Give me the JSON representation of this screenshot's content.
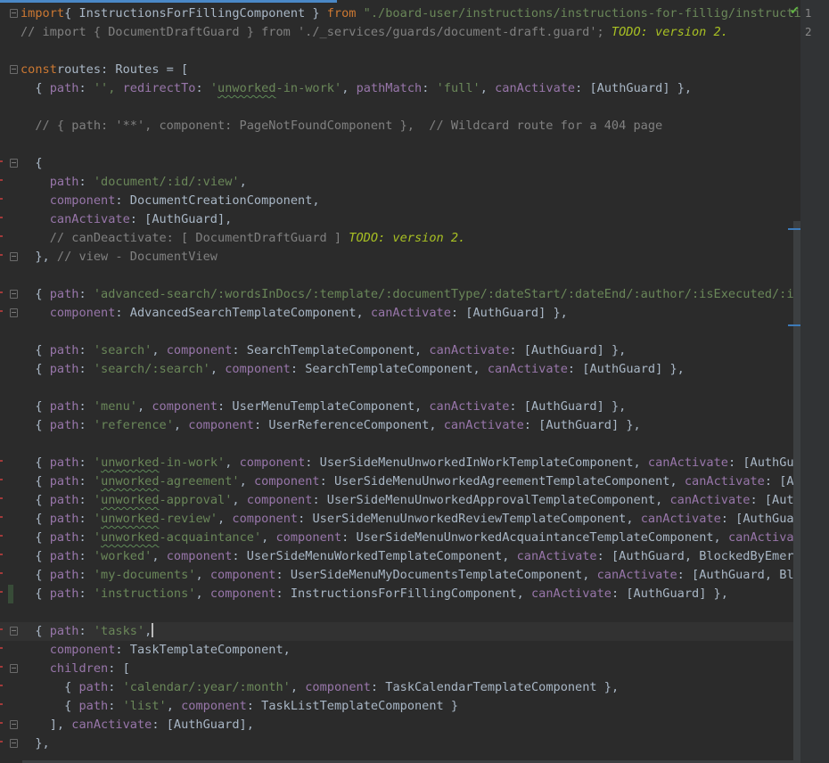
{
  "editor": {
    "language": "TypeScript",
    "line_numbers": [
      "1",
      "2"
    ],
    "lines": [
      [
        [
          "kw",
          "import"
        ],
        [
          "",
          "{ InstructionsForFillingComponent } "
        ],
        [
          "kw",
          "from"
        ],
        [
          "str",
          " \"./board-user/instructions/instructions-for-fillig/instructio"
        ]
      ],
      [
        [
          "cmt",
          "// import { DocumentDraftGuard } from './_services/guards/document-draft.guard'; "
        ],
        [
          "todo",
          "TODO: version 2."
        ]
      ],
      [],
      [
        [
          "kw",
          "const"
        ],
        [
          "",
          "routes: Routes = ["
        ]
      ],
      [
        [
          "",
          "  { "
        ],
        [
          "prop",
          "path"
        ],
        [
          "",
          ": "
        ],
        [
          "str",
          "'', "
        ],
        [
          "prop",
          "redirectTo"
        ],
        [
          "",
          ": "
        ],
        [
          "str",
          "'"
        ],
        [
          "str-typo",
          "unworked"
        ],
        [
          "str",
          "-in-work'"
        ],
        [
          "",
          ", "
        ],
        [
          "prop",
          "pathMatch"
        ],
        [
          "",
          ": "
        ],
        [
          "str",
          "'full'"
        ],
        [
          "",
          ", "
        ],
        [
          "prop",
          "canActivate"
        ],
        [
          "",
          ": [AuthGuard] },"
        ]
      ],
      [],
      [
        [
          "cmt",
          "  // { path: '**', component: PageNotFoundComponent },  // Wildcard route for a 404 page"
        ]
      ],
      [],
      [
        [
          "",
          "  {"
        ]
      ],
      [
        [
          "",
          "    "
        ],
        [
          "prop",
          "path"
        ],
        [
          "",
          ": "
        ],
        [
          "str",
          "'document/:id/:view'"
        ],
        [
          "",
          ","
        ]
      ],
      [
        [
          "",
          "    "
        ],
        [
          "prop",
          "component"
        ],
        [
          "",
          ": DocumentCreationComponent,"
        ]
      ],
      [
        [
          "",
          "    "
        ],
        [
          "prop",
          "canActivate"
        ],
        [
          "",
          ": [AuthGuard],"
        ]
      ],
      [
        [
          "cmt",
          "    // canDeactivate: [ DocumentDraftGuard ] "
        ],
        [
          "todo",
          "TODO: version 2."
        ]
      ],
      [
        [
          "",
          "  }, "
        ],
        [
          "cmt",
          "// view - DocumentView"
        ]
      ],
      [],
      [
        [
          "",
          "  { "
        ],
        [
          "prop",
          "path"
        ],
        [
          "",
          ": "
        ],
        [
          "str",
          "'advanced-search/:wordsInDocs/:template/:documentType/:dateStart/:dateEnd/:author/:isExecuted/:isAut"
        ]
      ],
      [
        [
          "",
          "    "
        ],
        [
          "prop",
          "component"
        ],
        [
          "",
          ": AdvancedSearchTemplateComponent, "
        ],
        [
          "prop",
          "canActivate"
        ],
        [
          "",
          ": [AuthGuard] },"
        ]
      ],
      [],
      [
        [
          "",
          "  { "
        ],
        [
          "prop",
          "path"
        ],
        [
          "",
          ": "
        ],
        [
          "str",
          "'search'"
        ],
        [
          "",
          ", "
        ],
        [
          "prop",
          "component"
        ],
        [
          "",
          ": SearchTemplateComponent, "
        ],
        [
          "prop",
          "canActivate"
        ],
        [
          "",
          ": [AuthGuard] },"
        ]
      ],
      [
        [
          "",
          "  { "
        ],
        [
          "prop",
          "path"
        ],
        [
          "",
          ": "
        ],
        [
          "str",
          "'search/:search'"
        ],
        [
          "",
          ", "
        ],
        [
          "prop",
          "component"
        ],
        [
          "",
          ": SearchTemplateComponent, "
        ],
        [
          "prop",
          "canActivate"
        ],
        [
          "",
          ": [AuthGuard] },"
        ]
      ],
      [],
      [
        [
          "",
          "  { "
        ],
        [
          "prop",
          "path"
        ],
        [
          "",
          ": "
        ],
        [
          "str",
          "'menu'"
        ],
        [
          "",
          ", "
        ],
        [
          "prop",
          "component"
        ],
        [
          "",
          ": UserMenuTemplateComponent, "
        ],
        [
          "prop",
          "canActivate"
        ],
        [
          "",
          ": [AuthGuard] },"
        ]
      ],
      [
        [
          "",
          "  { "
        ],
        [
          "prop",
          "path"
        ],
        [
          "",
          ": "
        ],
        [
          "str",
          "'reference'"
        ],
        [
          "",
          ", "
        ],
        [
          "prop",
          "component"
        ],
        [
          "",
          ": UserReferenceComponent, "
        ],
        [
          "prop",
          "canActivate"
        ],
        [
          "",
          ": [AuthGuard] },"
        ]
      ],
      [],
      [
        [
          "",
          "  { "
        ],
        [
          "prop",
          "path"
        ],
        [
          "",
          ": "
        ],
        [
          "str",
          "'"
        ],
        [
          "str-typo",
          "unworked"
        ],
        [
          "str",
          "-in-work'"
        ],
        [
          "",
          ", "
        ],
        [
          "prop",
          "component"
        ],
        [
          "",
          ": UserSideMenuUnworkedInWorkTemplateComponent, "
        ],
        [
          "prop",
          "canActivate"
        ],
        [
          "",
          ": [AuthGuard]"
        ]
      ],
      [
        [
          "",
          "  { "
        ],
        [
          "prop",
          "path"
        ],
        [
          "",
          ": "
        ],
        [
          "str",
          "'"
        ],
        [
          "str-typo",
          "unworked"
        ],
        [
          "str",
          "-agreement'"
        ],
        [
          "",
          ", "
        ],
        [
          "prop",
          "component"
        ],
        [
          "",
          ": UserSideMenuUnworkedAgreementTemplateComponent, "
        ],
        [
          "prop",
          "canActivate"
        ],
        [
          "",
          ": [AuthG"
        ]
      ],
      [
        [
          "",
          "  { "
        ],
        [
          "prop",
          "path"
        ],
        [
          "",
          ": "
        ],
        [
          "str",
          "'"
        ],
        [
          "str-typo",
          "unworked"
        ],
        [
          "str",
          "-approval'"
        ],
        [
          "",
          ", "
        ],
        [
          "prop",
          "component"
        ],
        [
          "",
          ": UserSideMenuUnworkedApprovalTemplateComponent, "
        ],
        [
          "prop",
          "canActivate"
        ],
        [
          "",
          ": [AuthGua"
        ]
      ],
      [
        [
          "",
          "  { "
        ],
        [
          "prop",
          "path"
        ],
        [
          "",
          ": "
        ],
        [
          "str",
          "'"
        ],
        [
          "str-typo",
          "unworked"
        ],
        [
          "str",
          "-review'"
        ],
        [
          "",
          ", "
        ],
        [
          "prop",
          "component"
        ],
        [
          "",
          ": UserSideMenuUnworkedReviewTemplateComponent, "
        ],
        [
          "prop",
          "canActivate"
        ],
        [
          "",
          ": [AuthGuard,"
        ]
      ],
      [
        [
          "",
          "  { "
        ],
        [
          "prop",
          "path"
        ],
        [
          "",
          ": "
        ],
        [
          "str",
          "'"
        ],
        [
          "str-typo",
          "unworked"
        ],
        [
          "str",
          "-acquaintance'"
        ],
        [
          "",
          ", "
        ],
        [
          "prop",
          "component"
        ],
        [
          "",
          ": UserSideMenuUnworkedAcquaintanceTemplateComponent, "
        ],
        [
          "prop",
          "canActivate"
        ],
        [
          "",
          ":"
        ]
      ],
      [
        [
          "",
          "  { "
        ],
        [
          "prop",
          "path"
        ],
        [
          "",
          ": "
        ],
        [
          "str",
          "'worked'"
        ],
        [
          "",
          ", "
        ],
        [
          "prop",
          "component"
        ],
        [
          "",
          ": UserSideMenuWorkedTemplateComponent, "
        ],
        [
          "prop",
          "canActivate"
        ],
        [
          "",
          ": [AuthGuard, BlockedByEmergenc"
        ]
      ],
      [
        [
          "",
          "  { "
        ],
        [
          "prop",
          "path"
        ],
        [
          "",
          ": "
        ],
        [
          "str",
          "'my-documents'"
        ],
        [
          "",
          ", "
        ],
        [
          "prop",
          "component"
        ],
        [
          "",
          ": UserSideMenuMyDocumentsTemplateComponent, "
        ],
        [
          "prop",
          "canActivate"
        ],
        [
          "",
          ": [AuthGuard, Blocke"
        ]
      ],
      [
        [
          "",
          "  { "
        ],
        [
          "prop",
          "path"
        ],
        [
          "",
          ": "
        ],
        [
          "str",
          "'instructions'"
        ],
        [
          "",
          ", "
        ],
        [
          "prop",
          "component"
        ],
        [
          "",
          ": InstructionsForFillingComponent, "
        ],
        [
          "prop",
          "canActivate"
        ],
        [
          "",
          ": [AuthGuard] },"
        ]
      ],
      [],
      [
        [
          "",
          "  { "
        ],
        [
          "prop",
          "path"
        ],
        [
          "",
          ": "
        ],
        [
          "str",
          "'tasks'"
        ],
        [
          "",
          ","
        ]
      ],
      [
        [
          "",
          "    "
        ],
        [
          "prop",
          "component"
        ],
        [
          "",
          ": TaskTemplateComponent,"
        ]
      ],
      [
        [
          "",
          "    "
        ],
        [
          "prop",
          "children"
        ],
        [
          "",
          ": ["
        ]
      ],
      [
        [
          "",
          "      { "
        ],
        [
          "prop",
          "path"
        ],
        [
          "",
          ": "
        ],
        [
          "str",
          "'calendar/:year/:month'"
        ],
        [
          "",
          ", "
        ],
        [
          "prop",
          "component"
        ],
        [
          "",
          ": TaskCalendarTemplateComponent },"
        ]
      ],
      [
        [
          "",
          "      { "
        ],
        [
          "prop",
          "path"
        ],
        [
          "",
          ": "
        ],
        [
          "str",
          "'list'"
        ],
        [
          "",
          ", "
        ],
        [
          "prop",
          "component"
        ],
        [
          "",
          ": TaskListTemplateComponent }"
        ]
      ],
      [
        [
          "",
          "    ], "
        ],
        [
          "prop",
          "canActivate"
        ],
        [
          "",
          ": [AuthGuard],"
        ]
      ],
      [
        [
          "",
          "  },"
        ]
      ]
    ]
  }
}
